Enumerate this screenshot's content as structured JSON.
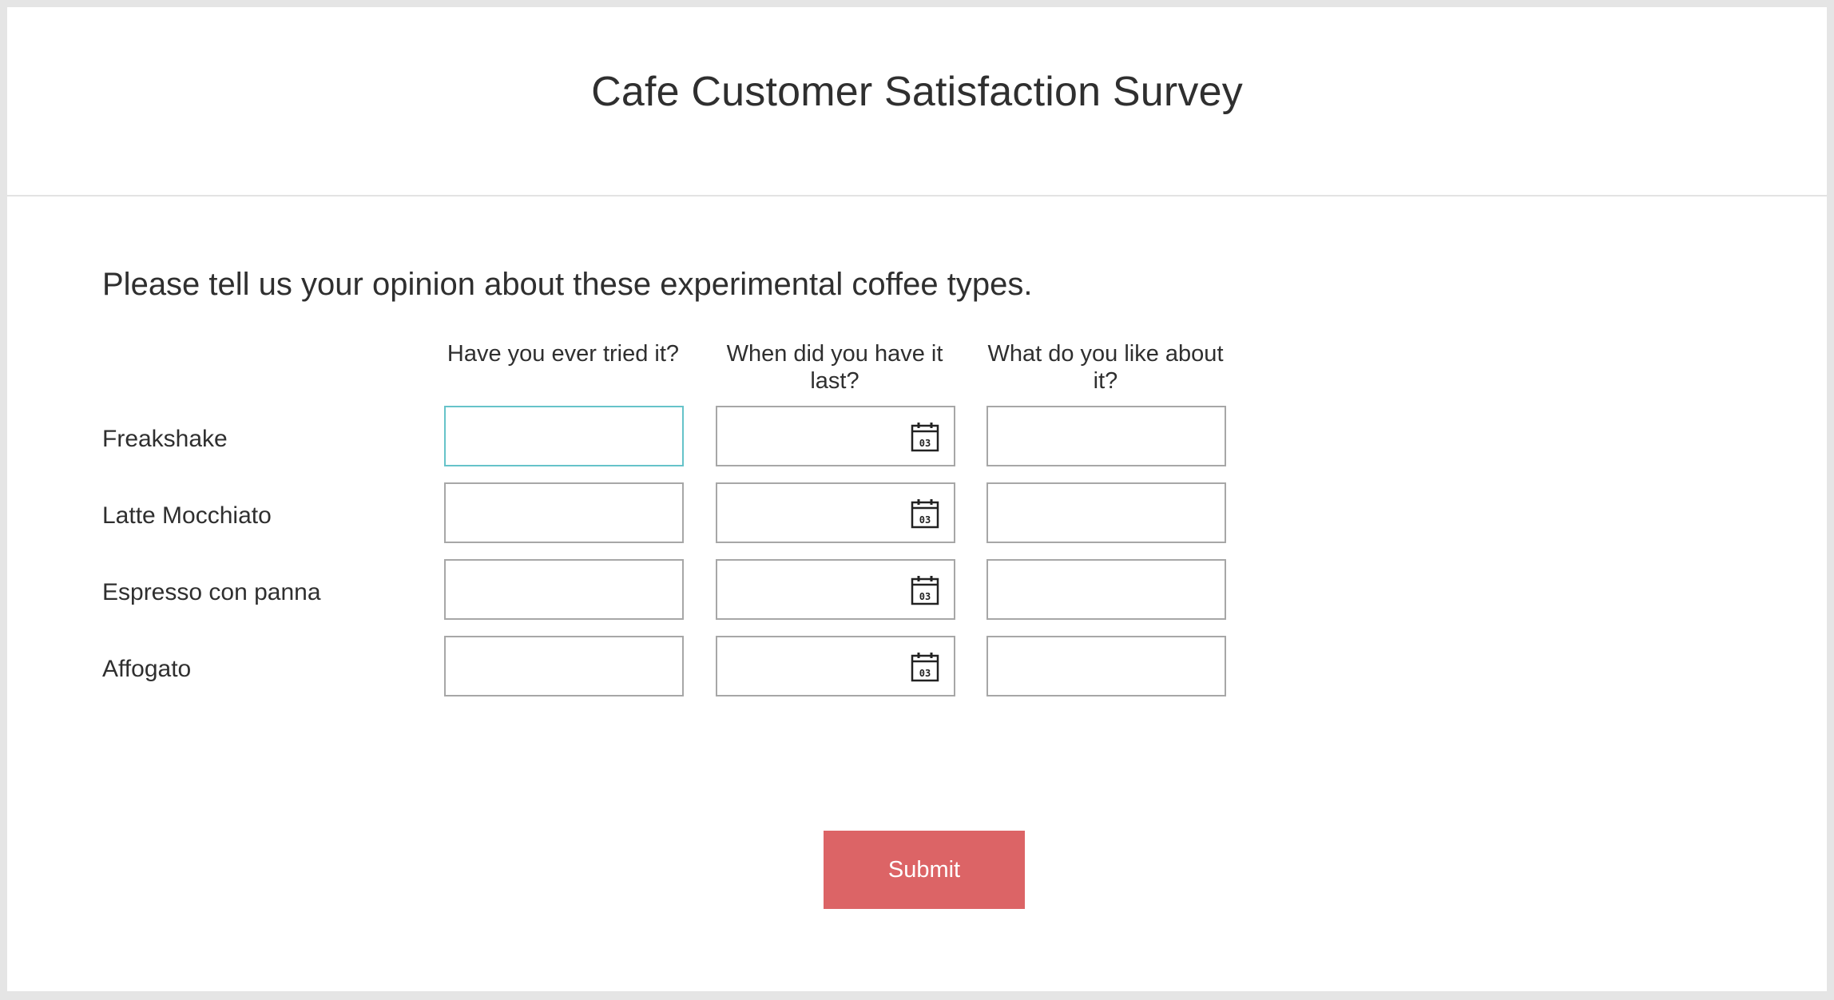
{
  "form": {
    "title": "Cafe Customer Satisfaction Survey",
    "question": "Please tell us your opinion about these experimental coffee types."
  },
  "matrix": {
    "columns": [
      "Have you ever tried it?",
      "When did you have it last?",
      "What do you like about it?"
    ],
    "rows": [
      {
        "label": "Freakshake",
        "tried": "",
        "last_date": "",
        "likes": ""
      },
      {
        "label": "Latte Mocchiato",
        "tried": "",
        "last_date": "",
        "likes": ""
      },
      {
        "label": "Espresso con panna",
        "tried": "",
        "last_date": "",
        "likes": ""
      },
      {
        "label": "Affogato",
        "tried": "",
        "last_date": "",
        "likes": ""
      }
    ],
    "calendar_icon": "calendar-icon",
    "calendar_icon_day": "03"
  },
  "submit": {
    "label": "Submit"
  },
  "colors": {
    "submit_bg": "#dc6466",
    "focus_border": "#66c3c9",
    "input_border": "#a7a7a7",
    "page_bg": "#e5e5e5"
  }
}
